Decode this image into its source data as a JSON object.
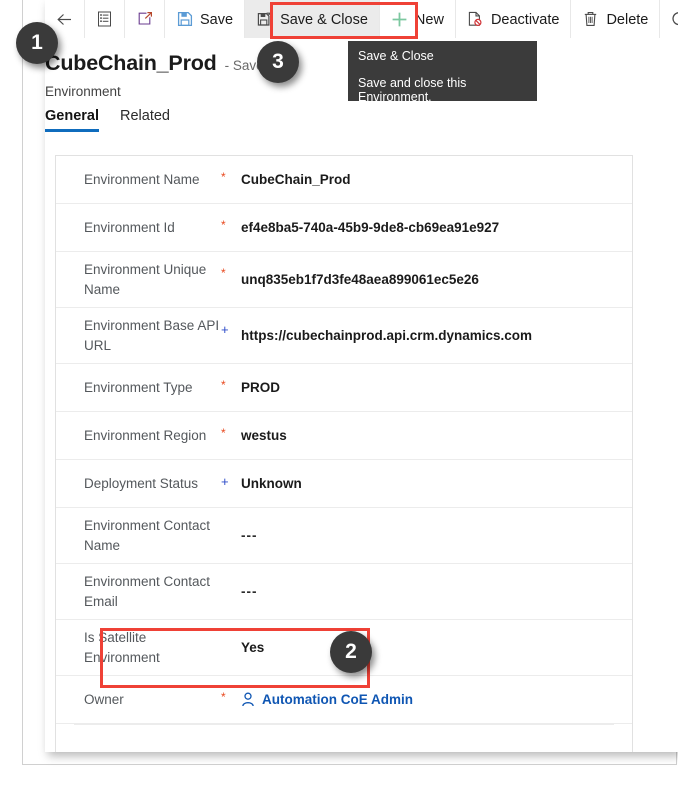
{
  "command_bar": {
    "items": [
      {
        "name": "back",
        "icon": "back-arrow-icon",
        "label": ""
      },
      {
        "name": "form-selector",
        "icon": "form-list-icon",
        "label": ""
      },
      {
        "name": "popout",
        "icon": "open-in-new-window-icon",
        "label": ""
      },
      {
        "name": "save",
        "icon": "save-floppy-icon",
        "label": "Save"
      },
      {
        "name": "save-and-close",
        "icon": "save-and-close-icon",
        "label": "Save & Close"
      },
      {
        "name": "new",
        "icon": "plus-icon",
        "label": "New"
      },
      {
        "name": "deactivate",
        "icon": "deactivate-page-icon",
        "label": "Deactivate"
      },
      {
        "name": "delete",
        "icon": "trash-icon",
        "label": "Delete"
      },
      {
        "name": "refresh",
        "icon": "refresh-icon",
        "label": ""
      }
    ]
  },
  "tooltip": {
    "title": "Save & Close",
    "description": "Save and close this Environment."
  },
  "callouts": [
    {
      "id": "1",
      "label": "1"
    },
    {
      "id": "2",
      "label": "2"
    },
    {
      "id": "3",
      "label": "3"
    }
  ],
  "record": {
    "title": "CubeChain_Prod",
    "state": "- Saved",
    "entity": "Environment"
  },
  "tabs": [
    {
      "label": "General",
      "active": true
    },
    {
      "label": "Related",
      "active": false
    }
  ],
  "form": {
    "fields": [
      {
        "label": "Environment Name",
        "marker": "required",
        "value": "CubeChain_Prod",
        "type": "text"
      },
      {
        "label": "Environment Id",
        "marker": "required",
        "value": "ef4e8ba5-740a-45b9-9de8-cb69ea91e927",
        "type": "text"
      },
      {
        "label": "Environment Unique Name",
        "marker": "required",
        "value": "unq835eb1f7d3fe48aea899061ec5e26",
        "type": "text"
      },
      {
        "label": "Environment Base API URL",
        "marker": "locked",
        "value": "https://cubechainprod.api.crm.dynamics.com",
        "type": "text"
      },
      {
        "label": "Environment Type",
        "marker": "required",
        "value": "PROD",
        "type": "text"
      },
      {
        "label": "Environment Region",
        "marker": "required",
        "value": "westus",
        "type": "text"
      },
      {
        "label": "Deployment Status",
        "marker": "locked",
        "value": "Unknown",
        "type": "text"
      },
      {
        "label": "Environment Contact Name",
        "marker": "none",
        "value": "---",
        "type": "empty"
      },
      {
        "label": "Environment Contact Email",
        "marker": "none",
        "value": "---",
        "type": "empty"
      },
      {
        "label": "Is Satellite Environment",
        "marker": "none",
        "value": "Yes",
        "type": "text"
      },
      {
        "label": "Owner",
        "marker": "required",
        "value": "Automation CoE Admin",
        "type": "lookup"
      }
    ]
  },
  "colors": {
    "accent": "#0f6cbd",
    "required_marker": "#e8491f",
    "locked_marker": "#2b4ac8",
    "annotation": "#ef4136",
    "lookup_link": "#0f56b3",
    "badge_bg": "#3a3a3a",
    "tooltip_bg": "#3b3b3b",
    "save_icon": "#5b9bd5"
  }
}
